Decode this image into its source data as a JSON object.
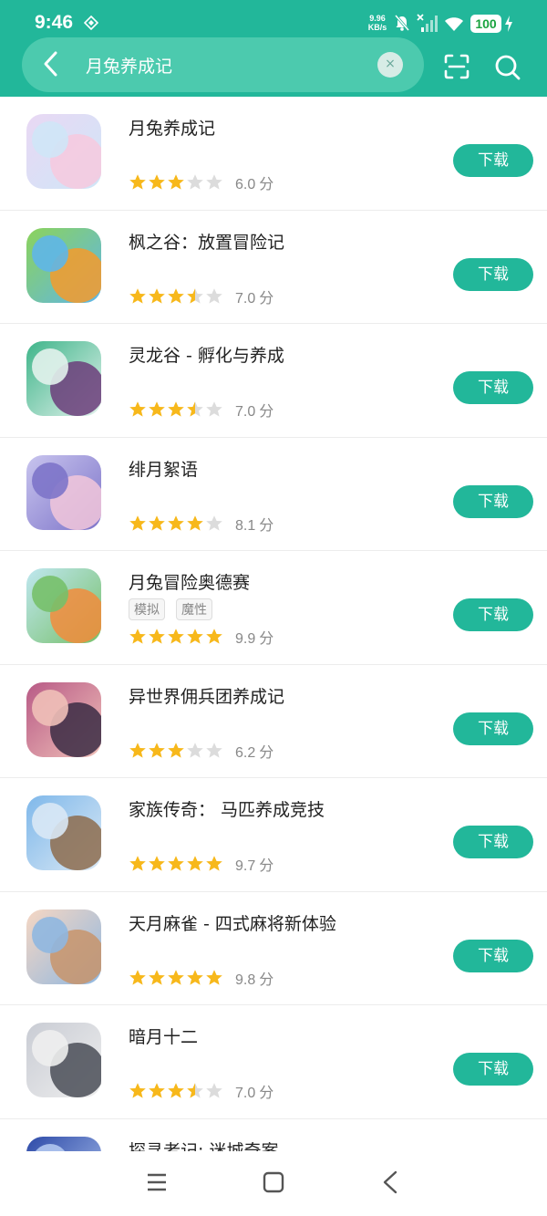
{
  "status_bar": {
    "time": "9:46",
    "net_speed_value": "9.96",
    "net_speed_unit": "KB/s",
    "battery": "100"
  },
  "search": {
    "query": "月兔养成记",
    "clear_symbol": "×"
  },
  "colors": {
    "accent": "#22b79a",
    "star_on": "#f7b81b",
    "star_off": "#dcdcdc"
  },
  "download_label": "下载",
  "score_unit": "分",
  "apps": [
    {
      "name": "月兔养成记",
      "stars": 3,
      "score": "6.0",
      "tags": []
    },
    {
      "name": "枫之谷：放置冒险记",
      "stars": 3.5,
      "score": "7.0",
      "tags": []
    },
    {
      "name": "灵龙谷 - 孵化与养成",
      "stars": 3.5,
      "score": "7.0",
      "tags": []
    },
    {
      "name": "绯月絮语",
      "stars": 4,
      "score": "8.1",
      "tags": []
    },
    {
      "name": "月兔冒险奥德赛",
      "stars": 5,
      "score": "9.9",
      "tags": [
        "模拟",
        "魔性"
      ]
    },
    {
      "name": "异世界佣兵团养成记",
      "stars": 3,
      "score": "6.2",
      "tags": []
    },
    {
      "name": "家族传奇： 马匹养成竞技",
      "stars": 5,
      "score": "9.7",
      "tags": []
    },
    {
      "name": "天月麻雀  -  四式麻将新体验",
      "stars": 5,
      "score": "9.8",
      "tags": []
    },
    {
      "name": "暗月十二",
      "stars": 3.5,
      "score": "7.0",
      "tags": []
    },
    {
      "name": "探寻者记: 迷城奇案",
      "stars": 0,
      "score": "",
      "tags": []
    }
  ],
  "icons": {
    "back": "back-arrow-icon",
    "clear": "clear-icon",
    "scan": "scan-icon",
    "search": "search-icon",
    "nav_menu": "menu-icon",
    "nav_home": "home-icon",
    "nav_back": "back-icon"
  }
}
